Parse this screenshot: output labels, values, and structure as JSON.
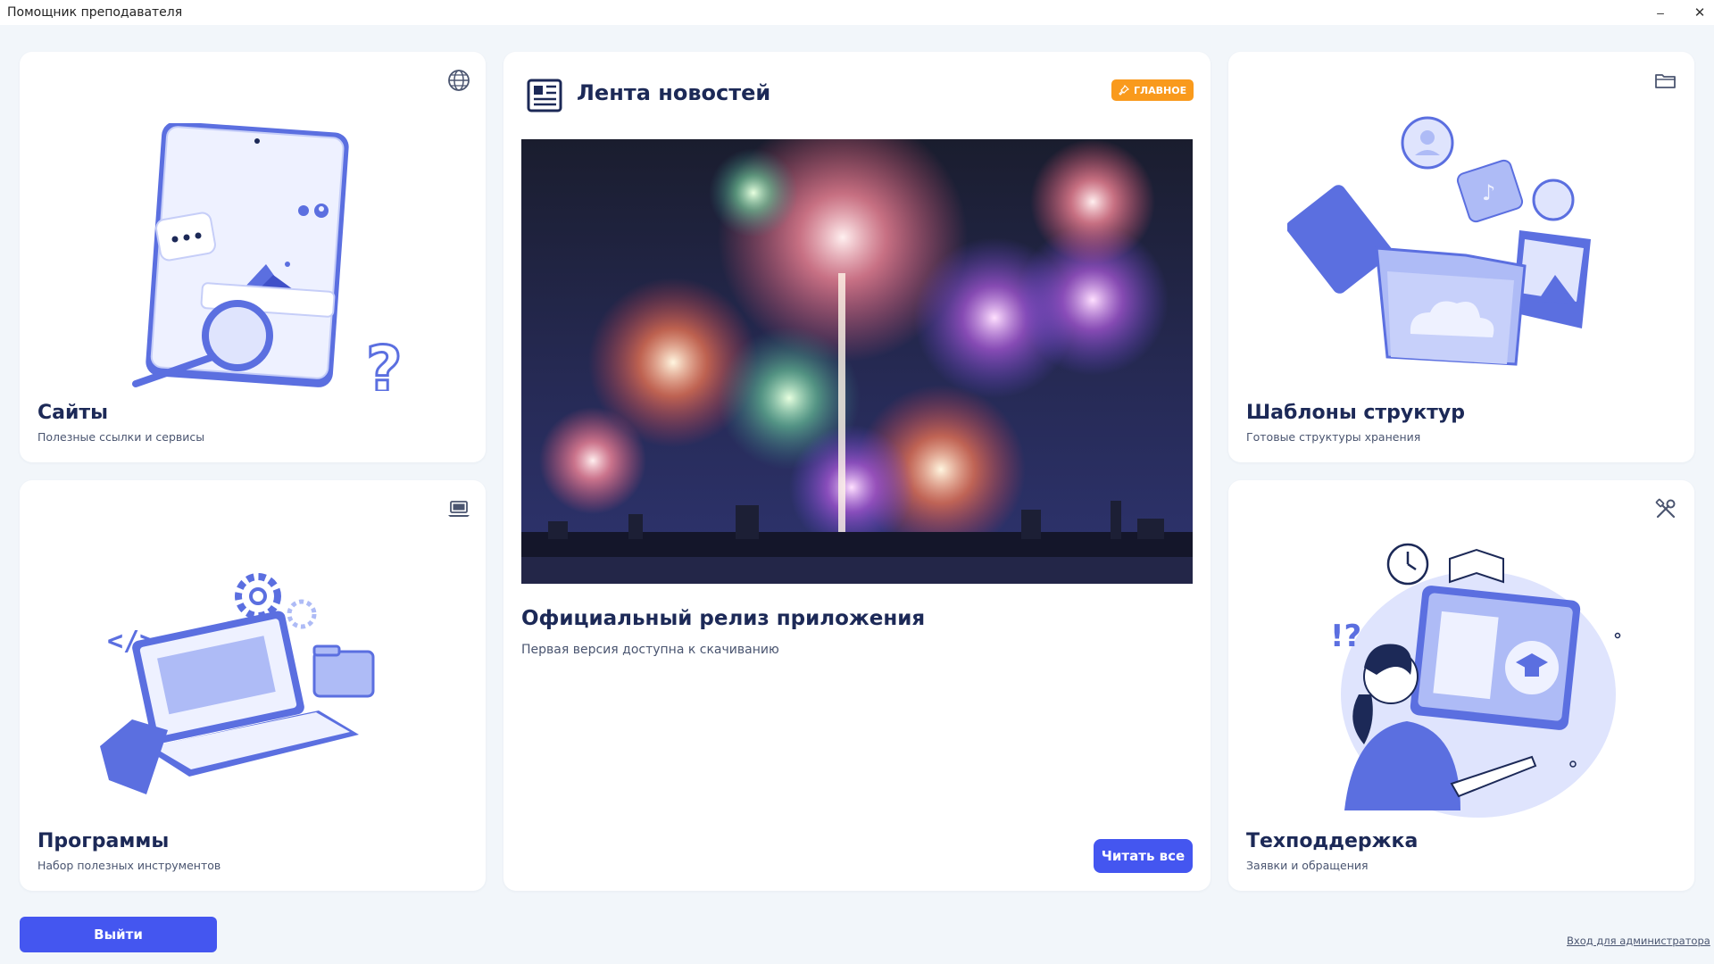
{
  "window": {
    "title": "Помощник преподавателя",
    "minimize_glyph": "–",
    "close_glyph": "✕"
  },
  "cards": {
    "sites": {
      "title": "Сайты",
      "subtitle": "Полезные ссылки и сервисы",
      "icon": "globe-icon"
    },
    "programs": {
      "title": "Программы",
      "subtitle": "Набор полезных инструментов",
      "icon": "laptop-icon"
    },
    "templates": {
      "title": "Шаблоны структур",
      "subtitle": "Готовые структуры хранения",
      "icon": "folder-icon"
    },
    "support": {
      "title": "Техподдержка",
      "subtitle": "Заявки и обращения",
      "icon": "tools-icon"
    }
  },
  "news": {
    "title": "Лента новостей",
    "badge": "ГЛАВНОЕ",
    "article_title": "Официальный релиз приложения",
    "article_desc": "Первая версия доступна к скачиванию",
    "read_all": "Читать все"
  },
  "footer": {
    "exit": "Выйти",
    "admin_link": "Вход для администратора"
  },
  "colors": {
    "accent": "#4456f0",
    "badge": "#f99a1c",
    "illustration": "#5b6fe0",
    "illustration_light": "#aebbf6",
    "title_text": "#1c2957"
  }
}
